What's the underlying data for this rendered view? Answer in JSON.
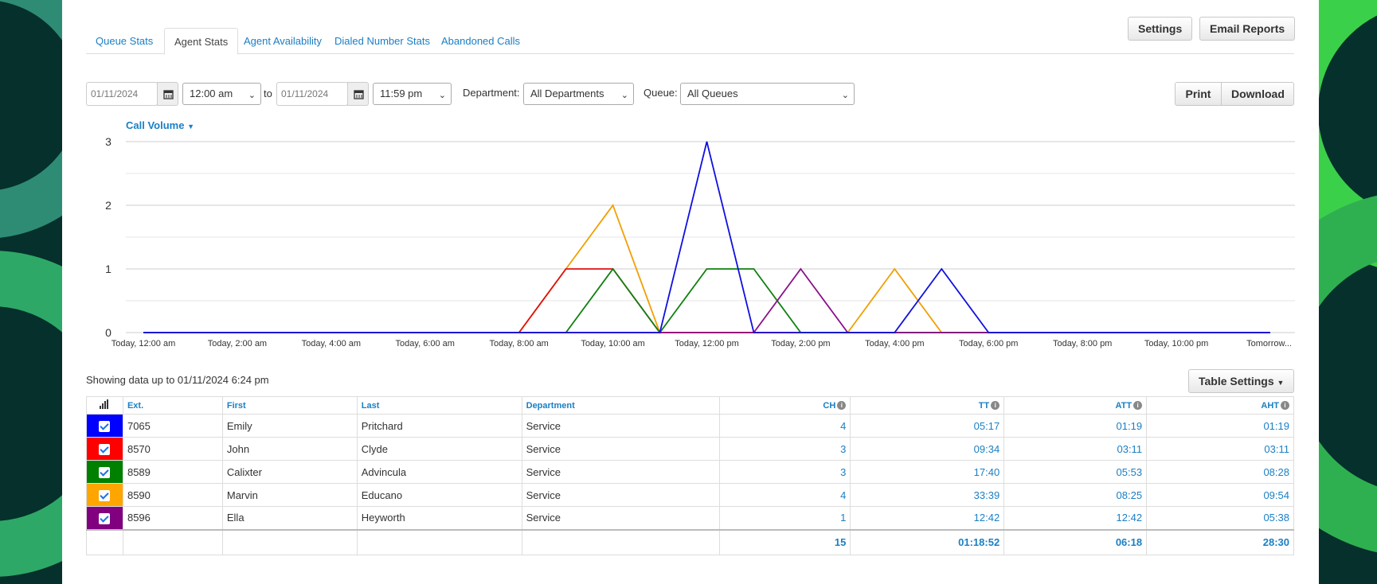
{
  "tabs": [
    {
      "label": "Queue Stats",
      "active": false
    },
    {
      "label": "Agent Stats",
      "active": true
    },
    {
      "label": "Agent Availability",
      "active": false
    },
    {
      "label": "Dialed Number Stats",
      "active": false
    },
    {
      "label": "Abandoned Calls",
      "active": false
    }
  ],
  "header_buttons": {
    "settings": "Settings",
    "email_reports": "Email Reports"
  },
  "filters": {
    "start_date": "01/11/2024",
    "start_time": "12:00 am",
    "to_label": "to",
    "end_date": "01/11/2024",
    "end_time": "11:59 pm",
    "department_label": "Department:",
    "department_value": "All Departments",
    "queue_label": "Queue:",
    "queue_value": "All Queues"
  },
  "actions": {
    "print": "Print",
    "download": "Download"
  },
  "chart_menu": "Call Volume",
  "chart_data": {
    "type": "line",
    "title": "Call Volume",
    "ylim": [
      0,
      3
    ],
    "yticks": [
      0,
      1,
      2,
      3
    ],
    "x": [
      "Today, 12:00 am",
      "Today, 1:00 am",
      "Today, 2:00 am",
      "Today, 3:00 am",
      "Today, 4:00 am",
      "Today, 5:00 am",
      "Today, 6:00 am",
      "Today, 7:00 am",
      "Today, 8:00 am",
      "Today, 9:00 am",
      "Today, 10:00 am",
      "Today, 11:00 am",
      "Today, 12:00 pm",
      "Today, 1:00 pm",
      "Today, 2:00 pm",
      "Today, 3:00 pm",
      "Today, 4:00 pm",
      "Today, 5:00 pm",
      "Today, 6:00 pm",
      "Today, 7:00 pm",
      "Today, 8:00 pm",
      "Today, 9:00 pm",
      "Today, 10:00 pm",
      "Today, 11:00 pm",
      "Tomorrow..."
    ],
    "xtick_labels": [
      "Today, 12:00 am",
      "Today, 2:00 am",
      "Today, 4:00 am",
      "Today, 6:00 am",
      "Today, 8:00 am",
      "Today, 10:00 am",
      "Today, 12:00 pm",
      "Today, 2:00 pm",
      "Today, 4:00 pm",
      "Today, 6:00 pm",
      "Today, 8:00 pm",
      "Today, 10:00 pm",
      "Tomorrow..."
    ],
    "grid": true,
    "series": [
      {
        "color": "#f0a000",
        "values": [
          0,
          0,
          0,
          0,
          0,
          0,
          0,
          0,
          0,
          1,
          2,
          0,
          0,
          0,
          0,
          0,
          1,
          0,
          0,
          0,
          0,
          0,
          0,
          0,
          0
        ]
      },
      {
        "color": "#e01010",
        "values": [
          0,
          0,
          0,
          0,
          0,
          0,
          0,
          0,
          0,
          1,
          1,
          0,
          0,
          0,
          0,
          0,
          0,
          0,
          0,
          0,
          0,
          0,
          0,
          0,
          0
        ]
      },
      {
        "color": "#108010",
        "values": [
          0,
          0,
          0,
          0,
          0,
          0,
          0,
          0,
          0,
          0,
          1,
          0,
          1,
          1,
          0,
          0,
          0,
          0,
          0,
          0,
          0,
          0,
          0,
          0,
          0
        ]
      },
      {
        "color": "#8a108a",
        "values": [
          0,
          0,
          0,
          0,
          0,
          0,
          0,
          0,
          0,
          0,
          0,
          0,
          0,
          0,
          1,
          0,
          0,
          0,
          0,
          0,
          0,
          0,
          0,
          0,
          0
        ]
      },
      {
        "color": "#1010e0",
        "values": [
          0,
          0,
          0,
          0,
          0,
          0,
          0,
          0,
          0,
          0,
          0,
          0,
          3,
          0,
          0,
          0,
          0,
          1,
          0,
          0,
          0,
          0,
          0,
          0,
          0
        ]
      }
    ]
  },
  "showing_text": "Showing data up to 01/11/2024 6:24 pm",
  "table_settings": "Table Settings",
  "table": {
    "headers": {
      "ext": "Ext.",
      "first": "First",
      "last": "Last",
      "department": "Department",
      "ch": "CH",
      "tt": "TT",
      "att": "ATT",
      "aht": "AHT"
    },
    "rows": [
      {
        "color": "#0000ff",
        "ext": "7065",
        "first": "Emily",
        "last": "Pritchard",
        "department": "Service",
        "ch": "4",
        "tt": "05:17",
        "att": "01:19",
        "aht": "01:19"
      },
      {
        "color": "#ff0000",
        "ext": "8570",
        "first": "John",
        "last": "Clyde",
        "department": "Service",
        "ch": "3",
        "tt": "09:34",
        "att": "03:11",
        "aht": "03:11"
      },
      {
        "color": "#008000",
        "ext": "8589",
        "first": "Calixter",
        "last": "Advincula",
        "department": "Service",
        "ch": "3",
        "tt": "17:40",
        "att": "05:53",
        "aht": "08:28"
      },
      {
        "color": "#ffa500",
        "ext": "8590",
        "first": "Marvin",
        "last": "Educano",
        "department": "Service",
        "ch": "4",
        "tt": "33:39",
        "att": "08:25",
        "aht": "09:54"
      },
      {
        "color": "#800080",
        "ext": "8596",
        "first": "Ella",
        "last": "Heyworth",
        "department": "Service",
        "ch": "1",
        "tt": "12:42",
        "att": "12:42",
        "aht": "05:38"
      }
    ],
    "totals": {
      "ch": "15",
      "tt": "01:18:52",
      "att": "06:18",
      "aht": "28:30"
    }
  }
}
